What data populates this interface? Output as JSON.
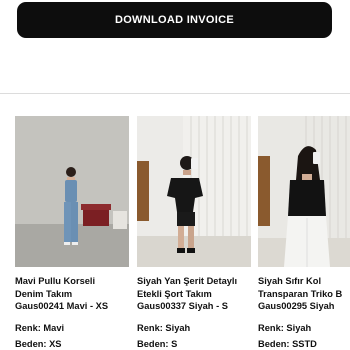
{
  "header": {
    "download_label": "DOWNLOAD INVOICE"
  },
  "products": [
    {
      "title_lines": [
        "Mavi Pullu Korseli",
        "Denim Takım",
        "Gaus00241 Mavi - XS"
      ],
      "color_label": "Renk: Mavi",
      "size_label": "Beden: XS",
      "image_icon": "product-photo-denim-jumpsuit"
    },
    {
      "title_lines": [
        "Siyah Yan Şerit Detaylı",
        "Etekli Şort Takım",
        "Gaus00337 Siyah - S"
      ],
      "color_label": "Renk: Siyah",
      "size_label": "Beden: S",
      "image_icon": "product-photo-black-short-set"
    },
    {
      "title_lines": [
        "Siyah Sıfır Kol",
        "Transparan Triko B",
        "Gaus00295 Siyah"
      ],
      "color_label": "Renk: Siyah",
      "size_label": "Beden: SSTD",
      "image_icon": "product-photo-black-knit-top"
    }
  ]
}
